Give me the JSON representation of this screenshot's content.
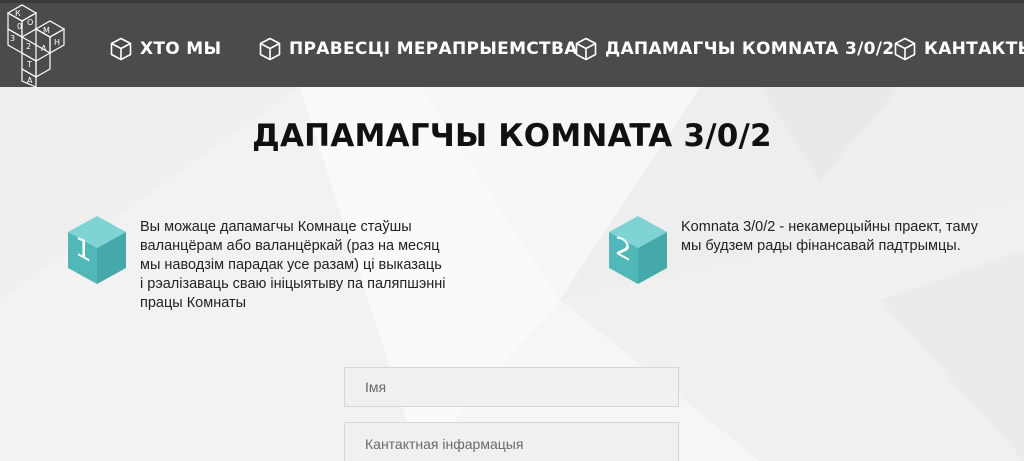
{
  "brand": {
    "logo_letters": [
      "К",
      "О",
      "М",
      "Н",
      "А",
      "Т",
      "А",
      "3",
      "0",
      "2"
    ],
    "logo_name": "logo-cube-icon"
  },
  "nav": {
    "items": [
      {
        "label": "ХТО МЫ",
        "icon": "cube-icon"
      },
      {
        "label": "ПРАВЕСЦІ МЕРАПРЫЕМСТВА",
        "icon": "cube-icon"
      },
      {
        "label": "ДАПАМАГЧЫ КОМNATA 3/0/2",
        "icon": "cube-icon"
      },
      {
        "label": "КАНТАКТЫ",
        "icon": "cube-icon"
      }
    ]
  },
  "main": {
    "title": "ДАПАМАГЧЫ КОМNATA 3/0/2",
    "features": [
      {
        "number": "1",
        "icon": "numbered-cube-icon",
        "lines": [
          "Вы можаце дапамагчы Комнаце стаўшы",
          "валанцёрам або валанцёркай (раз на месяц",
          "мы наводзім парадак усе разам) ці выказаць",
          "і рэалізаваць сваю ініцыятыву па паляпшэнні",
          "працы Комнаты"
        ]
      },
      {
        "number": "2",
        "icon": "numbered-cube-icon",
        "lines": [
          "Komnata 3/0/2 - некамерцыйны праект, таму",
          "мы будзем рады фінансавай падтрымцы."
        ]
      }
    ]
  },
  "form": {
    "name_placeholder": "Імя",
    "contact_placeholder": "Кантактная інфармацыя"
  },
  "colors": {
    "header_bg": "#4b4b4b",
    "accent_teal": "#5bbfc0",
    "title": "#111111"
  }
}
